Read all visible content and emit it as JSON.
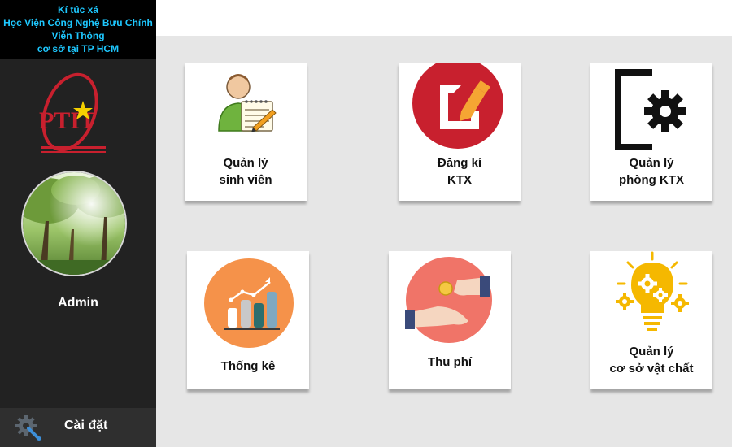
{
  "sidebar": {
    "header_lines": [
      "Kí túc xá",
      "Học Viện Công Nghệ Bưu Chính",
      "Viễn Thông",
      "cơ sở tại TP HCM"
    ],
    "logo_text": "PTIT",
    "username": "Admin",
    "settings_label": "Cài đặt",
    "settings_icon": "gear-wrench-icon"
  },
  "tiles": [
    {
      "line1": "Quản lý",
      "line2": "sinh viên",
      "icon": "student-notepad-icon"
    },
    {
      "line1": "Đăng kí",
      "line2": "KTX",
      "icon": "edit-document-icon"
    },
    {
      "line1": "Quản lý",
      "line2": "phòng KTX",
      "icon": "room-settings-icon"
    },
    {
      "line1": "Thống kê",
      "line2": "",
      "icon": "bar-chart-icon"
    },
    {
      "line1": "Thu phí",
      "line2": "",
      "icon": "payment-hands-icon"
    },
    {
      "line1": "Quản lý",
      "line2": "cơ sở vật chất",
      "icon": "lightbulb-gears-icon"
    }
  ],
  "colors": {
    "sidebar_bg": "#222222",
    "header_text": "#1ec8ff",
    "content_bg": "#e6e6e6",
    "register_red": "#c8202e",
    "stats_orange": "#f5924a",
    "fee_salmon": "#f07468",
    "facility_yellow": "#f5b800"
  }
}
